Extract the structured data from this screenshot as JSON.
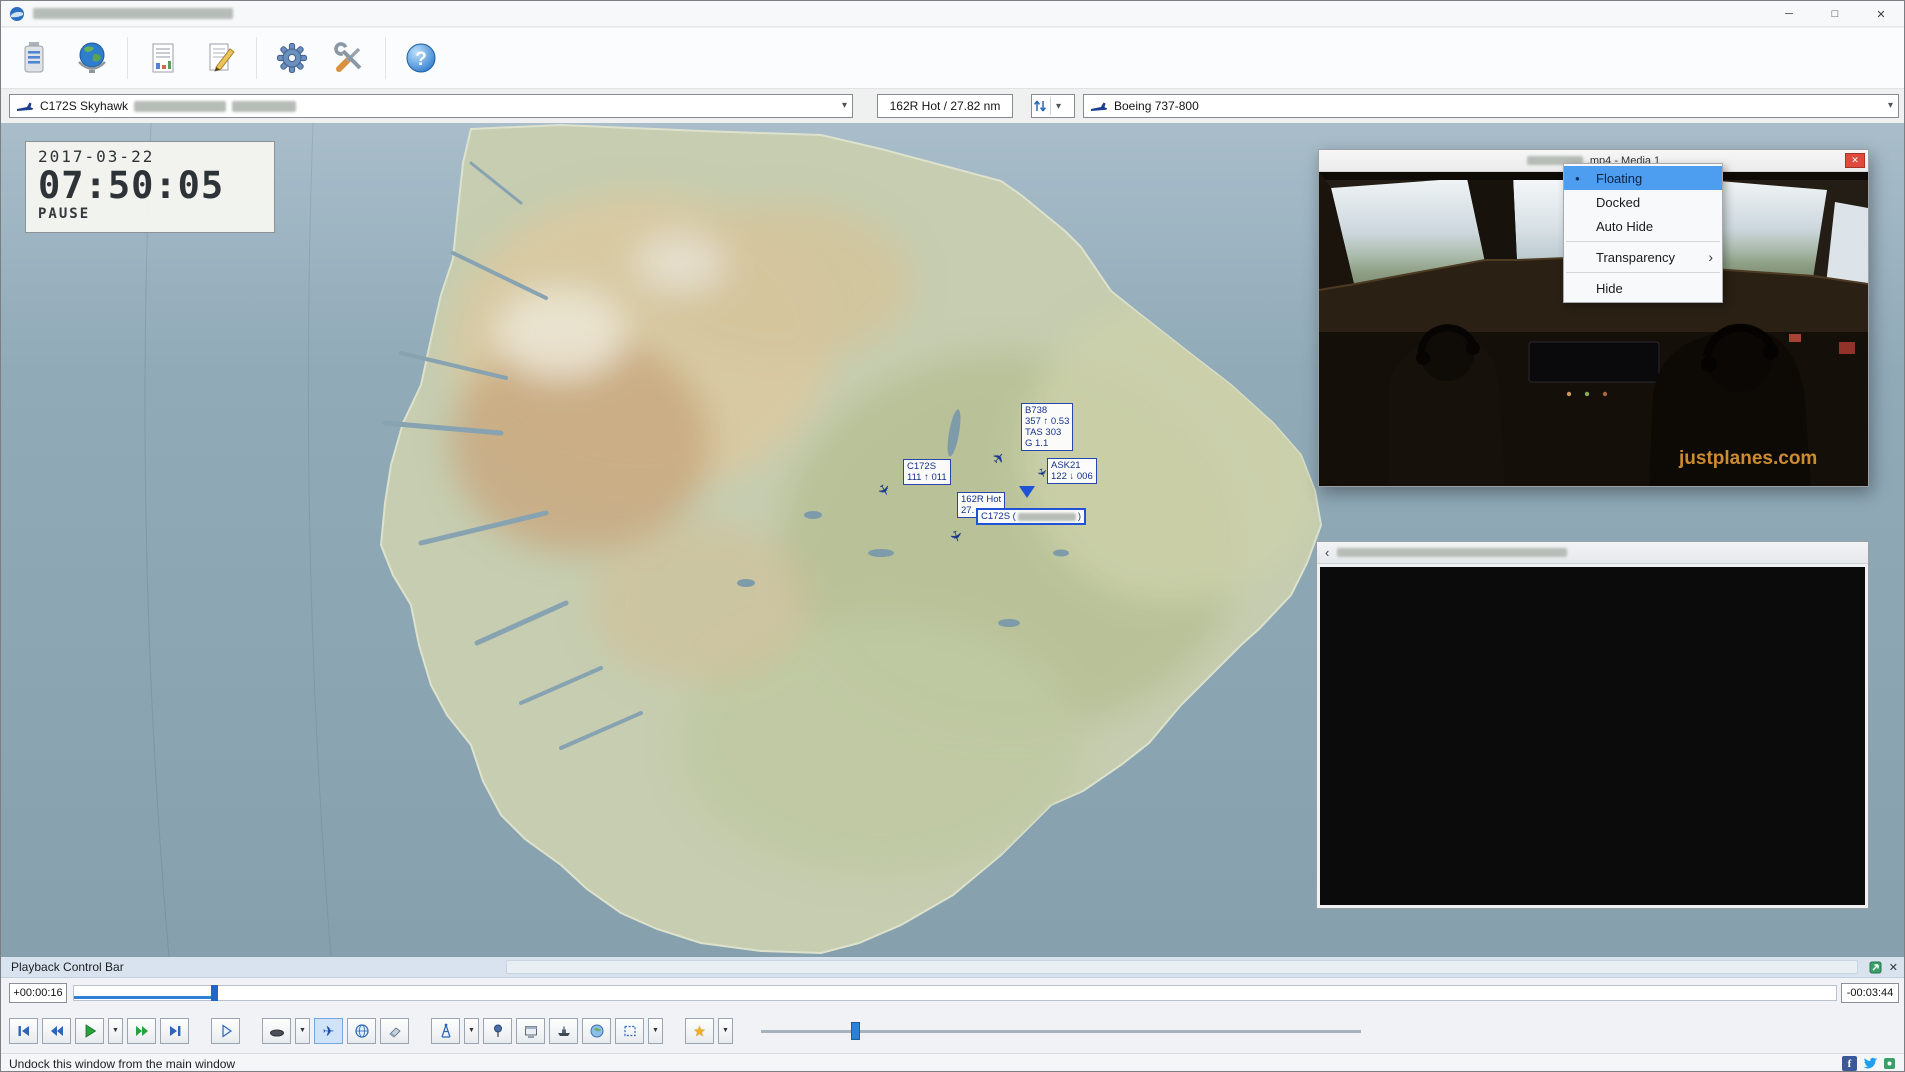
{
  "window": {
    "controls": {
      "minimize": "─",
      "maximize": "□",
      "close": "✕"
    }
  },
  "icons": {
    "dropdown_caret": "▾",
    "small_caret": "▼",
    "help": "?",
    "airplane": "✈",
    "star": "★",
    "bullet": "●",
    "submenu_arrow": "›",
    "collapse_left": "‹",
    "close": "✕",
    "facebook": "f"
  },
  "toolbar": {
    "button_icons": [
      "recorder-drive",
      "world-globe",
      "report-document",
      "edit-notes",
      "settings-gear",
      "tools",
      "help"
    ]
  },
  "selectors": {
    "aircraft_primary": "C172S Skyhawk",
    "range_info": "162R Hot / 27.82 nm",
    "aircraft_secondary": "Boeing 737-800"
  },
  "map": {
    "clock": {
      "date": "2017-03-22",
      "time": "07:50:05",
      "state": "PAUSE"
    },
    "labels": {
      "b738": {
        "l1": "B738",
        "l2": "357 ↑ 0.53",
        "l3": "TAS 303",
        "l4": "G 1.1"
      },
      "c172s": {
        "l1": "C172S",
        "l2": "111 ↑ 011"
      },
      "ask21": {
        "l1": "ASK21",
        "l2": "122 ↓ 006"
      },
      "hot": {
        "l1": "162R Hot",
        "l2": "27."
      },
      "selected": {
        "prefix": "C172S (",
        "suffix": ")"
      }
    }
  },
  "video_window": {
    "title_suffix": ".mp4 - Media 1",
    "watermark": "justplanes.com"
  },
  "context_menu": {
    "floating": "Floating",
    "docked": "Docked",
    "auto_hide": "Auto Hide",
    "transparency": "Transparency",
    "hide": "Hide"
  },
  "playback": {
    "title": "Playback Control Bar",
    "elapsed": "+00:00:16",
    "remaining": "-00:03:44",
    "transport_button_icons": [
      "skip-to-start",
      "rewind",
      "play",
      "play-options",
      "fast-forward",
      "skip-to-end",
      "step-forward",
      "camera-view",
      "camera-view-options",
      "aircraft-labels",
      "globe-view",
      "eraser",
      "antenna",
      "antenna-options",
      "pushpin",
      "panels",
      "ship",
      "world",
      "selection-box",
      "selection-options",
      "favorites-star",
      "favorites-options"
    ]
  },
  "statusbar": {
    "hint": "Undock this window from the main window"
  }
}
